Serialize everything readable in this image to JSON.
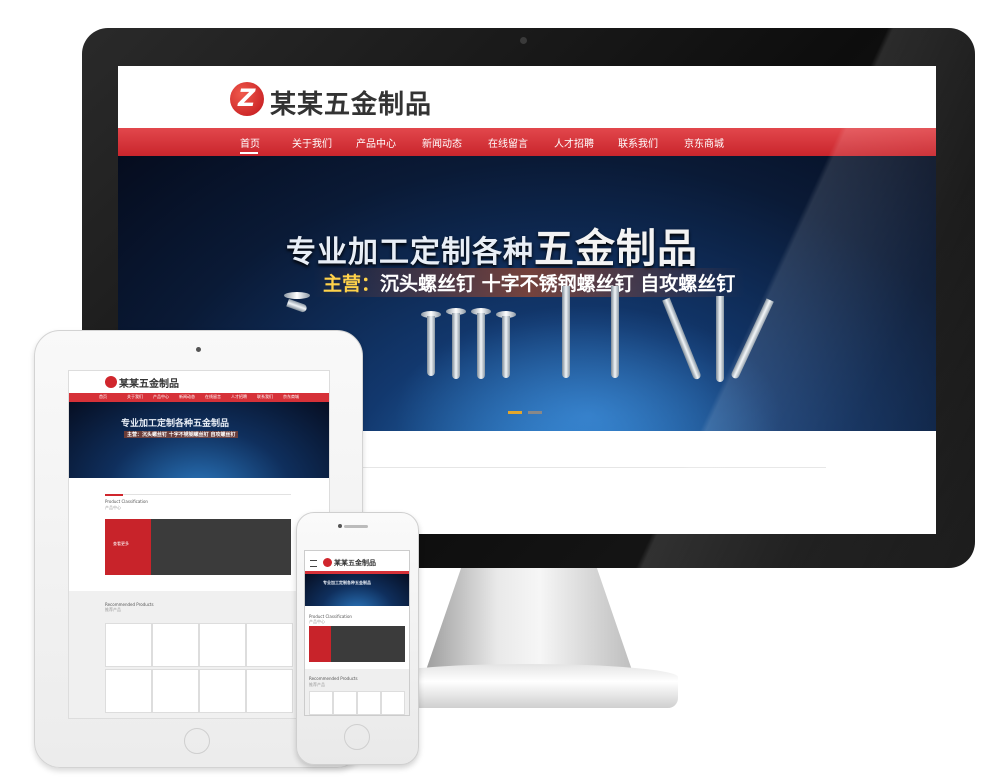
{
  "desktop": {
    "brand": "某某五金制品",
    "nav": [
      "首页",
      "关于我们",
      "产品中心",
      "新闻动态",
      "在线留言",
      "人才招聘",
      "联系我们",
      "京东商城"
    ],
    "active_nav": "首页",
    "hero": {
      "title_prefix": "专业加工定制各种",
      "title_emphasis": "五金制品",
      "sub_prefix": "主营：",
      "sub_text": "沉头螺丝钉 十字不锈钢螺丝钉 自攻螺丝钉"
    }
  },
  "tablet": {
    "brand": "某某五金制品",
    "nav": [
      "首页",
      "关于我们",
      "产品中心",
      "新闻动态",
      "在线留言",
      "人才招聘",
      "联系我们",
      "京东商城"
    ],
    "hero_title": "专业加工定制各种五金制品",
    "hero_sub": "主营：沉头螺丝钉 十字不锈钢螺丝钉 自攻螺丝钉",
    "classification_title": "Product Classification",
    "classification_sub": "产品中心",
    "more_label": "查看更多",
    "recommended_title": "Recommended Products",
    "recommended_sub": "推荐产品"
  },
  "phone": {
    "brand": "某某五金制品",
    "hero_title": "专业加工定制各种五金制品",
    "classification_title": "Product Classification",
    "classification_sub": "产品中心",
    "recommended_title": "Recommended Products",
    "recommended_sub": "推荐产品"
  },
  "colors": {
    "brand_red": "#d0262d",
    "nav_red": "#d63138",
    "monitor_black": "#111111"
  }
}
